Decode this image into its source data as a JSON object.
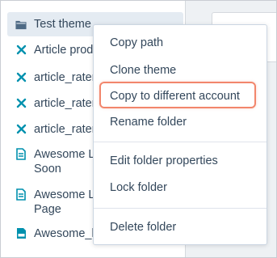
{
  "tree": {
    "items": [
      {
        "label": "Test theme",
        "icon": "folder-icon"
      },
      {
        "label": "Article prod",
        "icon": "module-icon"
      },
      {
        "label": "article_rater",
        "icon": "module-icon"
      },
      {
        "label": "article_rater",
        "icon": "module-icon"
      },
      {
        "label": "article_rater",
        "icon": "module-icon"
      },
      {
        "label": "Awesome L Soon",
        "icon": "page-template-icon"
      },
      {
        "label": "Awesome L Page",
        "icon": "page-template-icon"
      },
      {
        "label": "Awesome_l",
        "icon": "css-file-icon"
      }
    ]
  },
  "context_menu": {
    "items": [
      "Copy path",
      "Clone theme",
      "Copy to different account",
      "Rename folder",
      "Edit folder properties",
      "Lock folder",
      "Delete folder"
    ],
    "highlighted_item": "Copy to different account"
  },
  "colors": {
    "text": "#33475b",
    "icon_blue": "#0091ae",
    "selected_bg": "#e4ebf2",
    "highlight_border": "#f2866c"
  }
}
